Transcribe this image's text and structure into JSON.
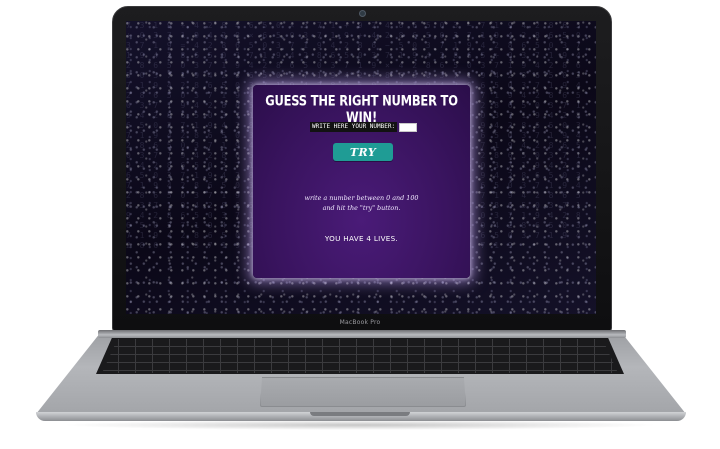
{
  "device": {
    "brand_label": "MacBook Pro"
  },
  "game": {
    "title": "GUESS THE RIGHT NUMBER TO WIN!",
    "input_label": "WRITE HERE YOUR NUMBER:",
    "input_value": "",
    "try_button_label": "TRY",
    "instructions_line1": "write a number between 0 and 100",
    "instructions_line2": "and hit the \"try\" button.",
    "lives_text": "YOU HAVE 4 LIVES."
  },
  "colors": {
    "panel_purple": "#3a1460",
    "button_teal": "#1f9c95",
    "screen_bg": "#0d0a1a"
  }
}
